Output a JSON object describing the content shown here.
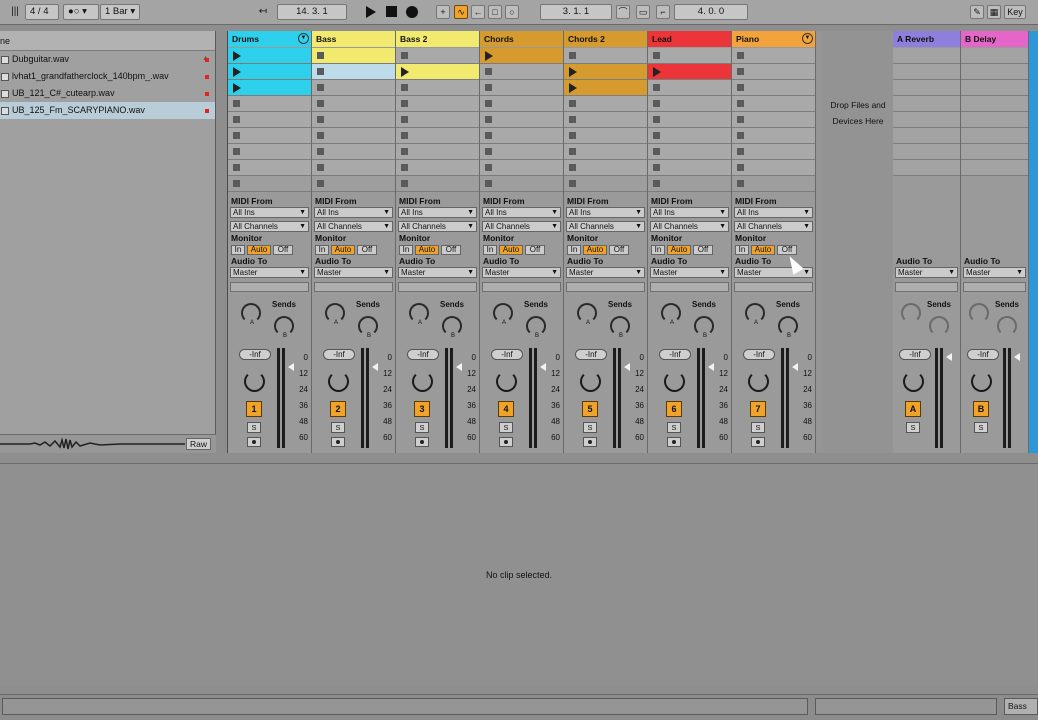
{
  "transport": {
    "left_icon": "|||",
    "time_signature": "4 / 4",
    "metronome": "●○ ▾",
    "quantize": "1 Bar ▾",
    "follow_icon": "↤",
    "arrangement_position": "14.   3.   1",
    "loop_start": "3.   1.   1",
    "loop_length": "4.   0.   0",
    "right_buttons": [
      "✎",
      "▦",
      "Key"
    ],
    "icons": [
      "draw-icon",
      "keyboard-icon",
      "key-map"
    ]
  },
  "browser": {
    "header_label": "ne",
    "files": [
      {
        "name": "Dubguitar.wav",
        "selected": false
      },
      {
        "name": "lvhat1_grandfatherclock_140bpm_.wav",
        "selected": false
      },
      {
        "name": "UB_121_C#_cutearp.wav",
        "selected": false
      },
      {
        "name": "UB_125_Fm_SCARYPIANO.wav",
        "selected": true
      }
    ],
    "raw_label": "Raw"
  },
  "labels": {
    "midi_from": "MIDI From",
    "all_ins": "All Ins",
    "all_channels": "All Channels",
    "monitor": "Monitor",
    "mon_in": "In",
    "mon_auto": "Auto",
    "mon_off": "Off",
    "audio_to": "Audio To",
    "master": "Master",
    "sends": "Sends",
    "knob_a": "A",
    "knob_b": "B",
    "inf": "-Inf",
    "solo": "S",
    "db0": "0",
    "db12": "12",
    "db24": "24",
    "db36": "36",
    "db48": "48",
    "db60": "60"
  },
  "tracks": [
    {
      "name": "Drums",
      "color": "#2ed0ec",
      "number": "1"
    },
    {
      "name": "Bass",
      "color": "#f1ea6e",
      "number": "2"
    },
    {
      "name": "Bass 2",
      "color": "#f1ea6e",
      "number": "3"
    },
    {
      "name": "Chords",
      "color": "#d69b2e",
      "number": "4"
    },
    {
      "name": "Chords 2",
      "color": "#d69b2e",
      "number": "5"
    },
    {
      "name": "Lead",
      "color": "#ec3538",
      "number": "6"
    },
    {
      "name": "Piano",
      "color": "#f2a33c",
      "number": "7"
    }
  ],
  "drop_area": {
    "line1": "Drop Files and",
    "line2": "Devices Here"
  },
  "returns": [
    {
      "name": "A Reverb",
      "color": "#8f7fdc",
      "letter": "A"
    },
    {
      "name": "B Delay",
      "color": "#e466c8",
      "letter": "B"
    }
  ],
  "detail": {
    "message": "No clip selected."
  },
  "status": {
    "track_label": "Bass"
  }
}
